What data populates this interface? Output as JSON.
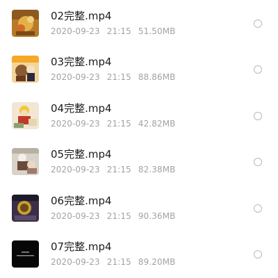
{
  "files": [
    {
      "name": "02完整.mp4",
      "date": "2020-09-23",
      "time": "21:15",
      "size": "51.50MB",
      "thumb_icon": "video-thumbnail-icon",
      "thumb_color": "#c98a2c"
    },
    {
      "name": "03完整.mp4",
      "date": "2020-09-23",
      "time": "21:15",
      "size": "88.86MB",
      "thumb_icon": "video-thumbnail-icon",
      "thumb_color": "#e8a83a"
    },
    {
      "name": "04完整.mp4",
      "date": "2020-09-23",
      "time": "21:15",
      "size": "42.82MB",
      "thumb_icon": "video-thumbnail-icon",
      "thumb_color": "#e6c98a"
    },
    {
      "name": "05完整.mp4",
      "date": "2020-09-23",
      "time": "21:15",
      "size": "82.38MB",
      "thumb_icon": "video-thumbnail-icon",
      "thumb_color": "#cfc7bd"
    },
    {
      "name": "06完整.mp4",
      "date": "2020-09-23",
      "time": "21:15",
      "size": "90.36MB",
      "thumb_icon": "video-thumbnail-icon",
      "thumb_color": "#4a3a5a"
    },
    {
      "name": "07完整.mp4",
      "date": "2020-09-23",
      "time": "21:15",
      "size": "89.20MB",
      "thumb_icon": "video-thumbnail-icon",
      "thumb_color": "#0b0b0b"
    }
  ]
}
